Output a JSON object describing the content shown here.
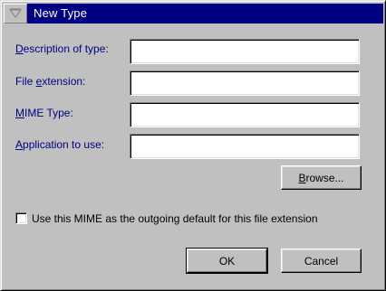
{
  "window": {
    "title": "New Type"
  },
  "fields": [
    {
      "label_pre": "",
      "label_accel": "D",
      "label_post": "escription of type:",
      "value": ""
    },
    {
      "label_pre": "File ",
      "label_accel": "e",
      "label_post": "xtension:",
      "value": ""
    },
    {
      "label_pre": "",
      "label_accel": "M",
      "label_post": "IME Type:",
      "value": ""
    },
    {
      "label_pre": "",
      "label_accel": "A",
      "label_post": "pplication to use:",
      "value": ""
    }
  ],
  "browse_button": {
    "accel": "B",
    "rest": "rowse..."
  },
  "checkbox": {
    "label": "Use this MIME as the outgoing default for this file extension",
    "checked": false
  },
  "ok_button": "OK",
  "cancel_button": "Cancel",
  "icons": {
    "system_menu": "system-menu-icon"
  }
}
